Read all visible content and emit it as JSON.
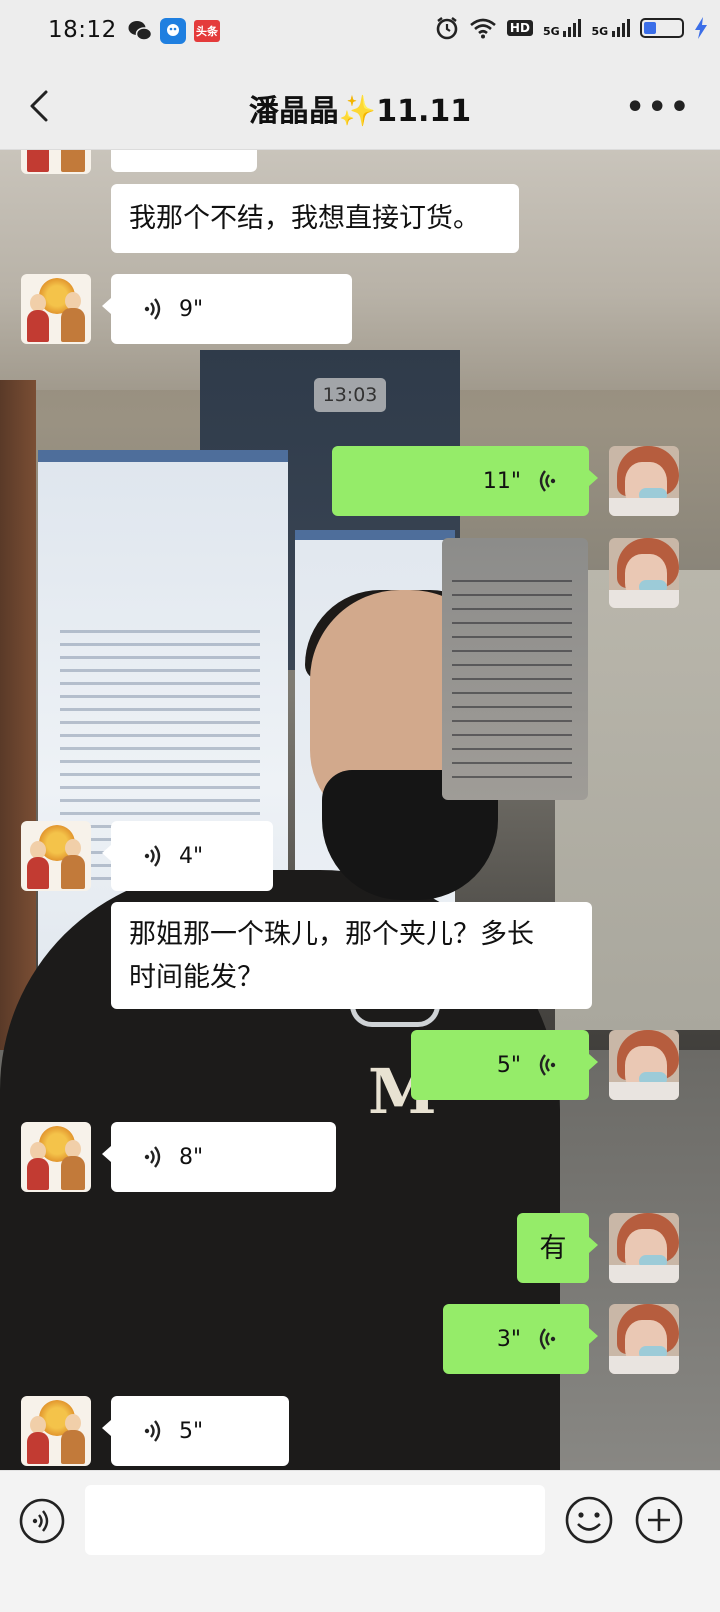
{
  "status_bar": {
    "time": "18:12",
    "toutiao_label": "头条",
    "hd_label": "HD",
    "signal1_label": "5G",
    "signal2_label": "5G",
    "battery_level_pct": 30
  },
  "header": {
    "title": "潘晶晶✨11.11"
  },
  "chat": {
    "timestamp": "13:03",
    "messages": [
      {
        "side": "left",
        "type": "voice",
        "duration": "9\""
      },
      {
        "side": "right",
        "type": "voice",
        "duration": "11\""
      },
      {
        "side": "right",
        "type": "image"
      },
      {
        "side": "left",
        "type": "voice",
        "duration": "4\""
      },
      {
        "side": "left",
        "type": "text",
        "text": "那姐那一个珠儿，那个夹儿？多长时间能发？"
      },
      {
        "side": "right",
        "type": "voice",
        "duration": "5\""
      },
      {
        "side": "left",
        "type": "voice",
        "duration": "8\""
      },
      {
        "side": "right",
        "type": "text",
        "text": "有"
      },
      {
        "side": "right",
        "type": "voice",
        "duration": "3\""
      },
      {
        "side": "left",
        "type": "voice",
        "duration": "5\""
      }
    ],
    "top_text": "我那个不结，我想直接订货。",
    "text_line1": "那姐那一个珠儿，那个夹儿？多长",
    "text_line2": "时间能发？"
  },
  "colors": {
    "sent_bubble": "#95ec69",
    "received_bubble": "#ffffff",
    "bar_bg": "#ededed"
  },
  "icons": [
    "back-arrow-icon",
    "more-icon",
    "voice-wave-icon",
    "voice-input-icon",
    "emoji-icon",
    "plus-icon",
    "wechat-icon",
    "alarm-icon",
    "wifi-icon"
  ]
}
